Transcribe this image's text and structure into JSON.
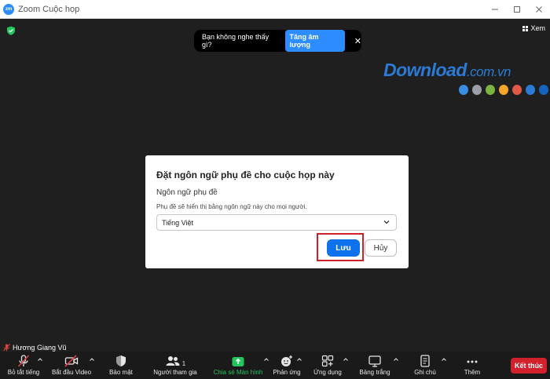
{
  "window": {
    "app_logo_text": "zm",
    "title": "Zoom Cuộc họp"
  },
  "meeting": {
    "view_label": "Xem",
    "toast": {
      "message": "Bạn không nghe thấy gì?",
      "action_label": "Tăng âm lượng",
      "close_glyph": "✕"
    },
    "participant_name": "Hương Giang Vũ"
  },
  "watermark": {
    "text": "Download",
    "suffix": ".com.vn",
    "dot_colors": [
      "#3a8de0",
      "#9aa0a6",
      "#7cb342",
      "#f4a62a",
      "#e05a48",
      "#2b7bd6",
      "#1565c0"
    ]
  },
  "dialog": {
    "title": "Đặt ngôn ngữ phụ đề cho cuộc họp này",
    "field_label": "Ngôn ngữ phụ đề",
    "hint": "Phụ đề sẽ hiển thị bằng ngôn ngữ này cho mọi người.",
    "selected_language": "Tiếng Việt",
    "save_label": "Lưu",
    "cancel_label": "Hủy"
  },
  "toolbar": {
    "mute_label": "Bỏ tắt tiếng",
    "video_label": "Bắt đầu Video",
    "security_label": "Bảo mật",
    "participants_label": "Người tham gia",
    "participants_count": "1",
    "share_label": "Chia sẻ Màn hình",
    "reactions_label": "Phản ứng",
    "apps_label": "Ứng dụng",
    "whiteboard_label": "Bảng trắng",
    "notes_label": "Ghi chú",
    "more_label": "Thêm",
    "end_label": "Kết thúc"
  },
  "colors": {
    "accent": "#0e72ed",
    "end_red": "#d2212c",
    "share_green": "#22c55e",
    "highlight_red": "#d0202a",
    "background": "#1f1f1f"
  }
}
